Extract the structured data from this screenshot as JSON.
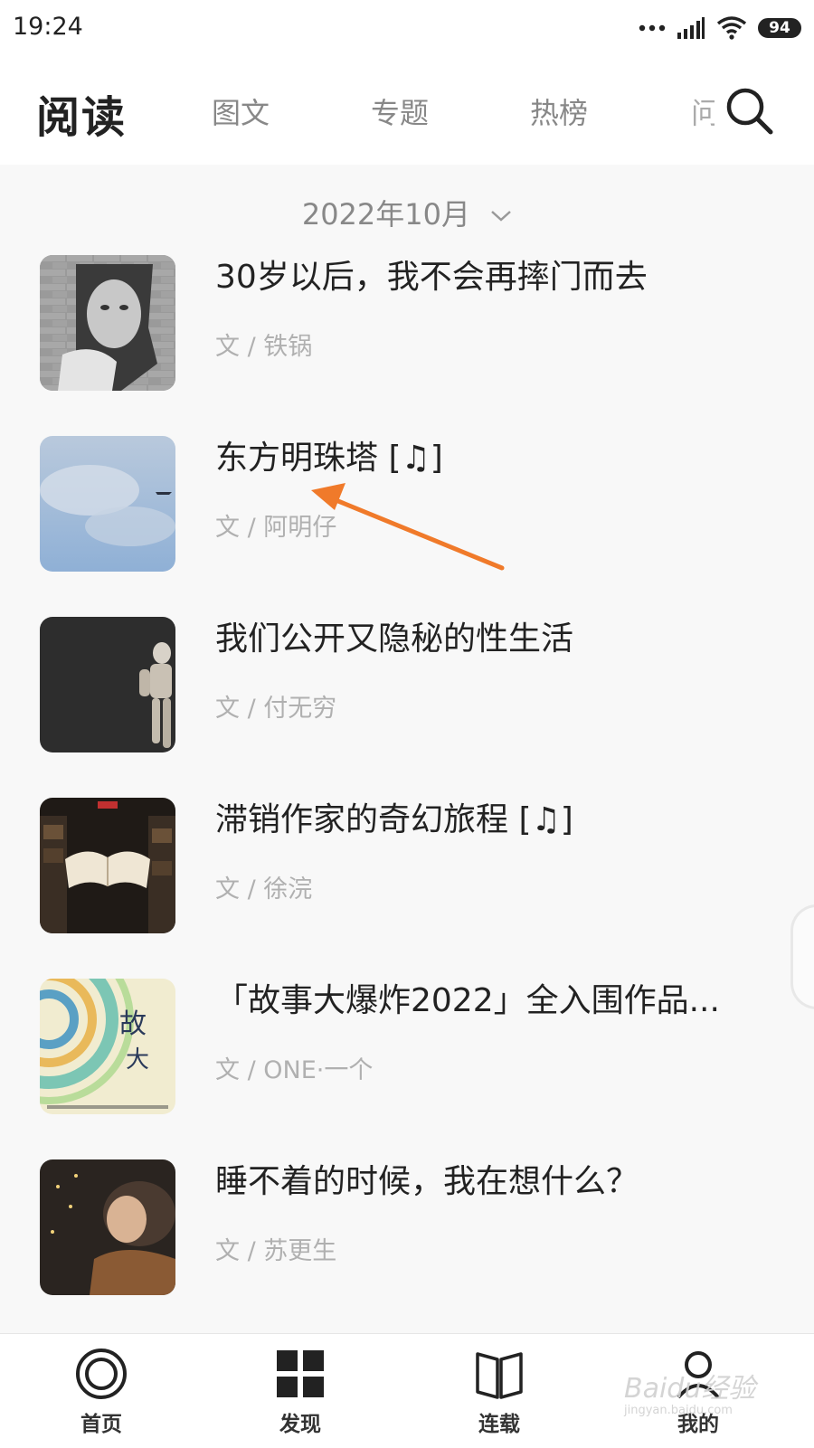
{
  "status_bar": {
    "time": "19:24",
    "battery": "94",
    "icons": [
      "more-dots-icon",
      "signal-icon",
      "wifi-icon",
      "battery-icon"
    ]
  },
  "header": {
    "title": "阅读",
    "tabs": [
      {
        "label": "图文"
      },
      {
        "label": "专题"
      },
      {
        "label": "热榜"
      },
      {
        "label": "问"
      }
    ],
    "search_icon": "search-icon"
  },
  "month_selector": {
    "label": "2022年10月",
    "icon": "chevron-down-icon"
  },
  "articles": [
    {
      "title": "30岁以后，我不会再摔门而去",
      "author": "文 / 铁锅"
    },
    {
      "title": "东方明珠塔 [♫]",
      "author": "文 / 阿明仔"
    },
    {
      "title": "我们公开又隐秘的性生活",
      "author": "文 / 付无穷"
    },
    {
      "title": "滞销作家的奇幻旅程 [♫]",
      "author": "文 / 徐浣"
    },
    {
      "title": "「故事大爆炸2022」全入围作品...",
      "author": "文 / ONE·一个"
    },
    {
      "title": "睡不着的时候，我在想什么？",
      "author": "文 / 苏更生"
    }
  ],
  "bottom_nav": [
    {
      "label": "首页",
      "icon": "home-icon"
    },
    {
      "label": "发现",
      "icon": "grid-icon"
    },
    {
      "label": "连载",
      "icon": "book-icon"
    },
    {
      "label": "我的",
      "icon": "profile-icon"
    }
  ],
  "watermark": {
    "text": "Baidu经验",
    "sub": "jingyan.baidu.com"
  },
  "colors": {
    "annotation_arrow": "#f07a2a",
    "background": "#f8f8f8",
    "text_primary": "#222222",
    "text_secondary": "#b0b0b0"
  }
}
